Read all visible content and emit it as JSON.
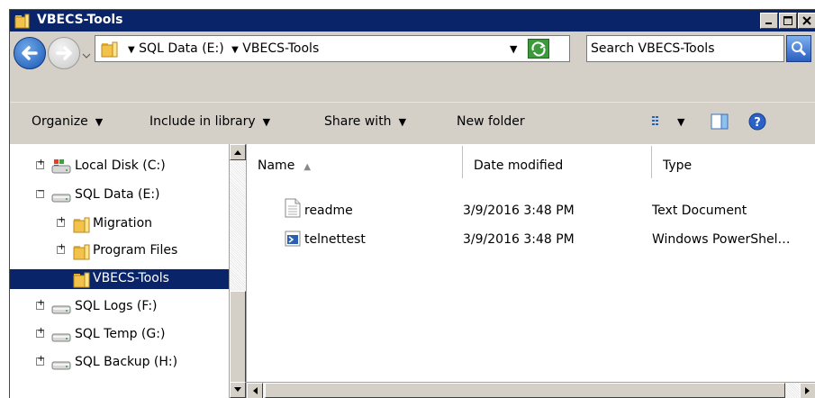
{
  "window": {
    "title": "VBECS-Tools",
    "controls": {
      "minimize": "minimize",
      "maximize": "maximize",
      "close": "close"
    }
  },
  "address": {
    "crumbs": [
      "SQL Data (E:)",
      "VBECS-Tools"
    ],
    "search_placeholder": "Search VBECS-Tools"
  },
  "toolbar": {
    "organize": "Organize",
    "include_in_library": "Include in library",
    "share_with": "Share with",
    "new_folder": "New folder"
  },
  "tree": {
    "items": [
      {
        "label": "Local Disk (C:)",
        "icon": "drive-icon",
        "expander": "+",
        "selected": false
      },
      {
        "label": "SQL Data (E:)",
        "icon": "drive-icon",
        "expander": "−",
        "selected": false
      },
      {
        "label": "Migration",
        "icon": "folder-icon",
        "expander": "+",
        "selected": false
      },
      {
        "label": "Program Files",
        "icon": "folder-icon",
        "expander": "+",
        "selected": false
      },
      {
        "label": "VBECS-Tools",
        "icon": "folder-icon",
        "expander": "",
        "selected": true
      },
      {
        "label": "SQL Logs (F:)",
        "icon": "drive-icon",
        "expander": "+",
        "selected": false
      },
      {
        "label": "SQL Temp (G:)",
        "icon": "drive-icon",
        "expander": "+",
        "selected": false
      },
      {
        "label": "SQL Backup (H:)",
        "icon": "drive-icon",
        "expander": "+",
        "selected": false
      }
    ]
  },
  "file_list": {
    "columns": [
      "Name",
      "Date modified",
      "Type"
    ],
    "rows": [
      {
        "name": "readme",
        "date": "3/9/2016 3:48 PM",
        "type": "Text Document",
        "icon": "text-file-icon"
      },
      {
        "name": "telnettest",
        "date": "3/9/2016 3:48 PM",
        "type": "Windows PowerShel…",
        "icon": "powershell-file-icon"
      }
    ]
  },
  "colors": {
    "titlebar": "#0a246a",
    "chrome": "#d4d0c8",
    "folder": "#f2c24a"
  }
}
